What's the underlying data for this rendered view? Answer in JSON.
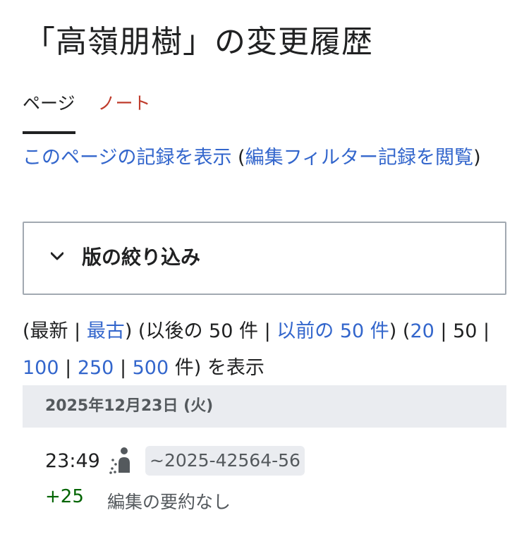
{
  "page": {
    "title": "「高嶺朋樹」の変更履歴"
  },
  "tabs": [
    {
      "label": "ページ"
    },
    {
      "label": "ノート"
    }
  ],
  "log_links": {
    "view_log": "このページの記録を表示",
    "paren_open": " (",
    "filter_log": "編集フィルター記録を閲覧",
    "paren_close": ")"
  },
  "filter": {
    "label": "版の絞り込み"
  },
  "navigation": {
    "open1": "(",
    "newest": "最新",
    "sep1": " | ",
    "oldest": "最古",
    "mid1": ") (",
    "later": "以後の 50 件",
    "sep2": " | ",
    "earlier": "以前の 50 件",
    "mid2": ") (",
    "opt20": "20",
    "sep3": " | ",
    "opt50": "50",
    "sep4": " | ",
    "opt100": "100",
    "sep5": " | ",
    "opt250": "250",
    "sep6": " | ",
    "opt500": "500",
    "suffix": " 件) を表示"
  },
  "history": {
    "date": "2025年12月23日 (火)",
    "entries": [
      {
        "time": "23:49",
        "user": "~2025-42564-56",
        "diff": "+25",
        "summary": "編集の要約なし"
      }
    ]
  },
  "colors": {
    "link": "#3366cc",
    "note_tab": "#bf3c2c",
    "positive_diff": "#006400",
    "date_header_bg": "#eaecf0"
  },
  "icons": {
    "filter_toggle": "chevron-down-icon",
    "user": "temp-user-icon"
  }
}
